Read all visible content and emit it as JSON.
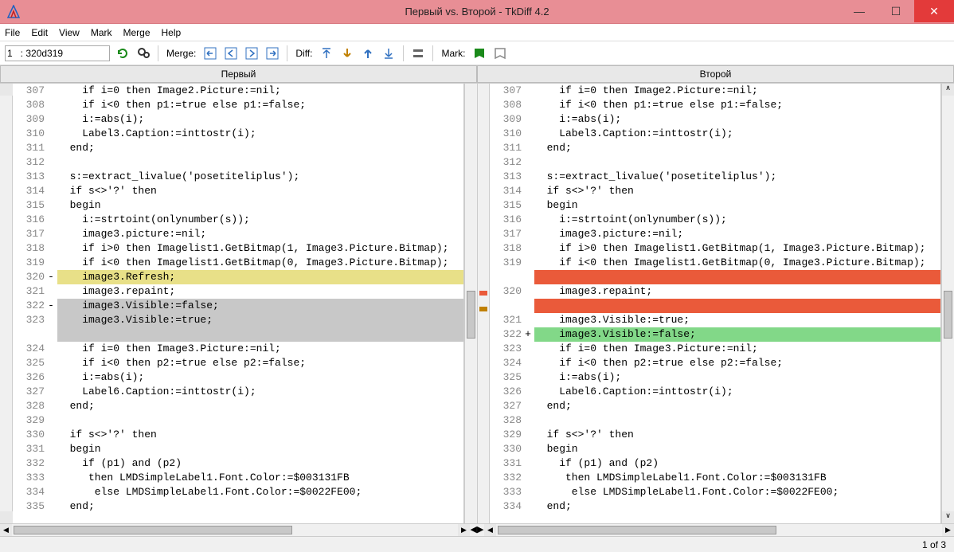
{
  "title": "Первый vs. Второй - TkDiff 4.2",
  "menu": [
    "File",
    "Edit",
    "View",
    "Mark",
    "Merge",
    "Help"
  ],
  "toolbar": {
    "nav_value": "1   : 320d319",
    "merge_label": "Merge:",
    "diff_label": "Diff:",
    "mark_label": "Mark:"
  },
  "panes": {
    "left": {
      "title": "Первый",
      "lines": [
        {
          "n": "307",
          "m": "",
          "t": "    if i=0 then Image2.Picture:=nil;"
        },
        {
          "n": "308",
          "m": "",
          "t": "    if i<0 then p1:=true else p1:=false;"
        },
        {
          "n": "309",
          "m": "",
          "t": "    i:=abs(i);"
        },
        {
          "n": "310",
          "m": "",
          "t": "    Label3.Caption:=inttostr(i);"
        },
        {
          "n": "311",
          "m": "",
          "t": "  end;"
        },
        {
          "n": "312",
          "m": "",
          "t": ""
        },
        {
          "n": "313",
          "m": "",
          "t": "  s:=extract_livalue('posetiteliplus');"
        },
        {
          "n": "314",
          "m": "",
          "t": "  if s<>'?' then"
        },
        {
          "n": "315",
          "m": "",
          "t": "  begin"
        },
        {
          "n": "316",
          "m": "",
          "t": "    i:=strtoint(onlynumber(s));"
        },
        {
          "n": "317",
          "m": "",
          "t": "    image3.picture:=nil;"
        },
        {
          "n": "318",
          "m": "",
          "t": "    if i>0 then Imagelist1.GetBitmap(1, Image3.Picture.Bitmap);"
        },
        {
          "n": "319",
          "m": "",
          "t": "    if i<0 then Imagelist1.GetBitmap(0, Image3.Picture.Bitmap);"
        },
        {
          "n": "320",
          "m": "-",
          "t": "    image3.Refresh;",
          "hl": "yellow"
        },
        {
          "n": "321",
          "m": "",
          "t": "    image3.repaint;"
        },
        {
          "n": "322",
          "m": "-",
          "t": "    image3.Visible:=false;",
          "hl": "gray"
        },
        {
          "n": "323",
          "m": "",
          "t": "    image3.Visible:=true;",
          "hl": "gray"
        },
        {
          "n": "",
          "m": "",
          "t": "",
          "hl": "gray"
        },
        {
          "n": "324",
          "m": "",
          "t": "    if i=0 then Image3.Picture:=nil;"
        },
        {
          "n": "325",
          "m": "",
          "t": "    if i<0 then p2:=true else p2:=false;"
        },
        {
          "n": "326",
          "m": "",
          "t": "    i:=abs(i);"
        },
        {
          "n": "327",
          "m": "",
          "t": "    Label6.Caption:=inttostr(i);"
        },
        {
          "n": "328",
          "m": "",
          "t": "  end;"
        },
        {
          "n": "329",
          "m": "",
          "t": ""
        },
        {
          "n": "330",
          "m": "",
          "t": "  if s<>'?' then"
        },
        {
          "n": "331",
          "m": "",
          "t": "  begin"
        },
        {
          "n": "332",
          "m": "",
          "t": "    if (p1) and (p2)"
        },
        {
          "n": "333",
          "m": "",
          "t": "     then LMDSimpleLabel1.Font.Color:=$003131FB"
        },
        {
          "n": "334",
          "m": "",
          "t": "      else LMDSimpleLabel1.Font.Color:=$0022FE00;"
        },
        {
          "n": "335",
          "m": "",
          "t": "  end;"
        }
      ]
    },
    "right": {
      "title": "Второй",
      "lines": [
        {
          "n": "307",
          "m": "",
          "t": "    if i=0 then Image2.Picture:=nil;"
        },
        {
          "n": "308",
          "m": "",
          "t": "    if i<0 then p1:=true else p1:=false;"
        },
        {
          "n": "309",
          "m": "",
          "t": "    i:=abs(i);"
        },
        {
          "n": "310",
          "m": "",
          "t": "    Label3.Caption:=inttostr(i);"
        },
        {
          "n": "311",
          "m": "",
          "t": "  end;"
        },
        {
          "n": "312",
          "m": "",
          "t": ""
        },
        {
          "n": "313",
          "m": "",
          "t": "  s:=extract_livalue('posetiteliplus');"
        },
        {
          "n": "314",
          "m": "",
          "t": "  if s<>'?' then"
        },
        {
          "n": "315",
          "m": "",
          "t": "  begin"
        },
        {
          "n": "316",
          "m": "",
          "t": "    i:=strtoint(onlynumber(s));"
        },
        {
          "n": "317",
          "m": "",
          "t": "    image3.picture:=nil;"
        },
        {
          "n": "318",
          "m": "",
          "t": "    if i>0 then Imagelist1.GetBitmap(1, Image3.Picture.Bitmap);"
        },
        {
          "n": "319",
          "m": "",
          "t": "    if i<0 then Imagelist1.GetBitmap(0, Image3.Picture.Bitmap);"
        },
        {
          "n": "",
          "m": "",
          "t": "",
          "hl": "red"
        },
        {
          "n": "320",
          "m": "",
          "t": "    image3.repaint;"
        },
        {
          "n": "",
          "m": "",
          "t": "",
          "hl": "red"
        },
        {
          "n": "321",
          "m": "",
          "t": "    image3.Visible:=true;"
        },
        {
          "n": "322",
          "m": "+",
          "t": "    image3.Visible:=false;",
          "hl": "green"
        },
        {
          "n": "323",
          "m": "",
          "t": "    if i=0 then Image3.Picture:=nil;"
        },
        {
          "n": "324",
          "m": "",
          "t": "    if i<0 then p2:=true else p2:=false;"
        },
        {
          "n": "325",
          "m": "",
          "t": "    i:=abs(i);"
        },
        {
          "n": "326",
          "m": "",
          "t": "    Label6.Caption:=inttostr(i);"
        },
        {
          "n": "327",
          "m": "",
          "t": "  end;"
        },
        {
          "n": "328",
          "m": "",
          "t": ""
        },
        {
          "n": "329",
          "m": "",
          "t": "  if s<>'?' then"
        },
        {
          "n": "330",
          "m": "",
          "t": "  begin"
        },
        {
          "n": "331",
          "m": "",
          "t": "    if (p1) and (p2)"
        },
        {
          "n": "332",
          "m": "",
          "t": "     then LMDSimpleLabel1.Font.Color:=$003131FB"
        },
        {
          "n": "333",
          "m": "",
          "t": "      else LMDSimpleLabel1.Font.Color:=$0022FE00;"
        },
        {
          "n": "334",
          "m": "",
          "t": "  end;"
        }
      ]
    }
  },
  "status": "1 of 3"
}
